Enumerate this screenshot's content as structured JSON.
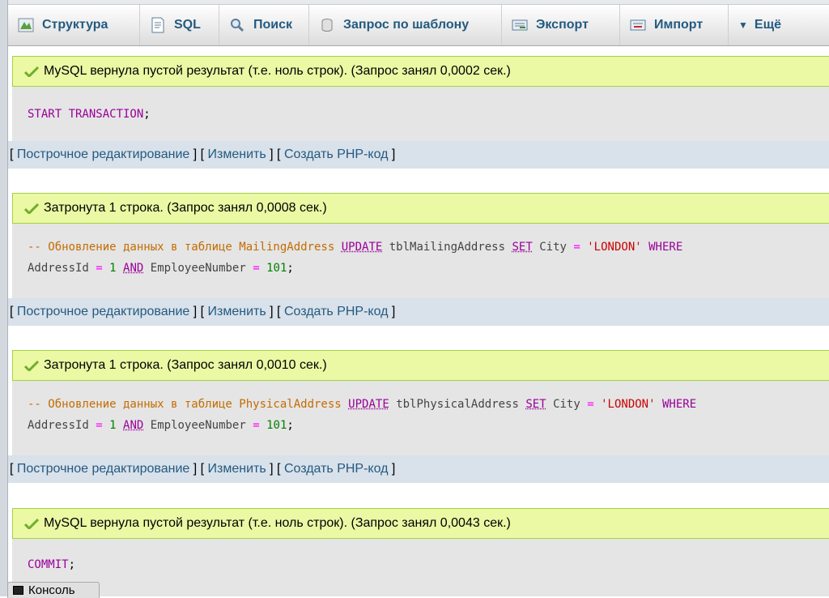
{
  "tabs": [
    {
      "label": "Структура",
      "icon": "structure-icon"
    },
    {
      "label": "SQL",
      "icon": "sql-icon"
    },
    {
      "label": "Поиск",
      "icon": "search-icon"
    },
    {
      "label": "Запрос по шаблону",
      "icon": "query-icon"
    },
    {
      "label": "Экспорт",
      "icon": "export-icon"
    },
    {
      "label": "Импорт",
      "icon": "import-icon"
    },
    {
      "label": "Ещё",
      "icon": "chevron-down-icon"
    }
  ],
  "results": [
    {
      "message": "MySQL вернула пустой результат (т.е. ноль строк). (Запрос занял 0,0002 сек.)",
      "code_lines": [
        "START TRANSACTION;"
      ]
    },
    {
      "message": "Затронута 1 строка. (Запрос занял 0,0008 сек.)",
      "code_lines": [
        "-- Обновление данных в таблице MailingAddress UPDATE tblMailingAddress SET City = 'LONDON' WHERE",
        "AddressId = 1 AND EmployeeNumber = 101;"
      ]
    },
    {
      "message": "Затронута 1 строка. (Запрос занял 0,0010 сек.)",
      "code_lines": [
        "-- Обновление данных в таблице PhysicalAddress UPDATE tblPhysicalAddress SET City = 'LONDON' WHERE",
        "AddressId = 1 AND EmployeeNumber = 101;"
      ]
    },
    {
      "message": "MySQL вернула пустой результат (т.е. ноль строк). (Запрос занял 0,0043 сек.)",
      "code_lines": [
        "COMMIT;"
      ]
    }
  ],
  "actions": {
    "inline_edit": "Построчное редактирование",
    "edit": "Изменить",
    "create_php": "Создать PHP-код"
  },
  "console_label": "Консоль",
  "colors": {
    "link": "#235a81",
    "success_bg": "#ebf8a4",
    "code_bg": "#e5e5e5",
    "actions_bg": "#d9e1ea"
  }
}
